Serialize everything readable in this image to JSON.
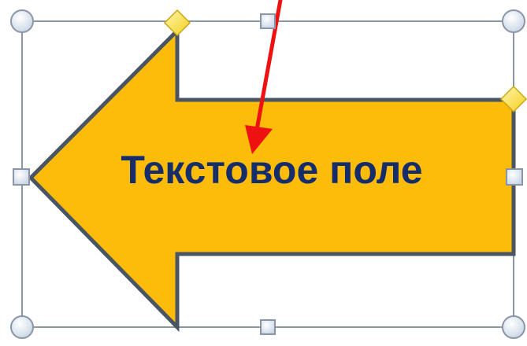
{
  "shape": {
    "kind": "left-arrow",
    "text": "Текстовое поле",
    "fill_color": "#FDBB0A",
    "outline_color": "#4A5563",
    "text_color": "#162D6B"
  },
  "selection": {
    "frame_color": "#8A95A5",
    "corner_handle": "circle",
    "side_handle": "square",
    "handle_fill": "#DCE8F4",
    "adjust_handle": "diamond",
    "adjust_handle_color": "#FFE24D"
  },
  "pointer": {
    "kind": "red-arrow",
    "color": "#EE1111"
  }
}
